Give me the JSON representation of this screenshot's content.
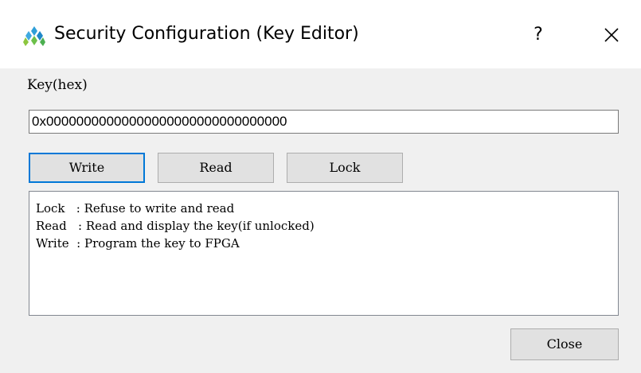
{
  "window": {
    "title": "Security Configuration (Key Editor)",
    "help_label": "?",
    "app_icon": "gowin-app-icon",
    "close_icon": "close-icon"
  },
  "form": {
    "key_label": "Key(hex)",
    "key_value": "0x00000000000000000000000000000000"
  },
  "buttons": {
    "write": "Write",
    "read": "Read",
    "lock": "Lock",
    "close": "Close"
  },
  "info": {
    "lines": [
      "Lock   : Refuse to write and read",
      "Read   : Read and display the key(if unlocked)",
      "Write  : Program the key to FPGA"
    ]
  },
  "colors": {
    "accent": "#0078d7",
    "client_bg": "#f0f0f0",
    "button_bg": "#e1e1e1"
  }
}
